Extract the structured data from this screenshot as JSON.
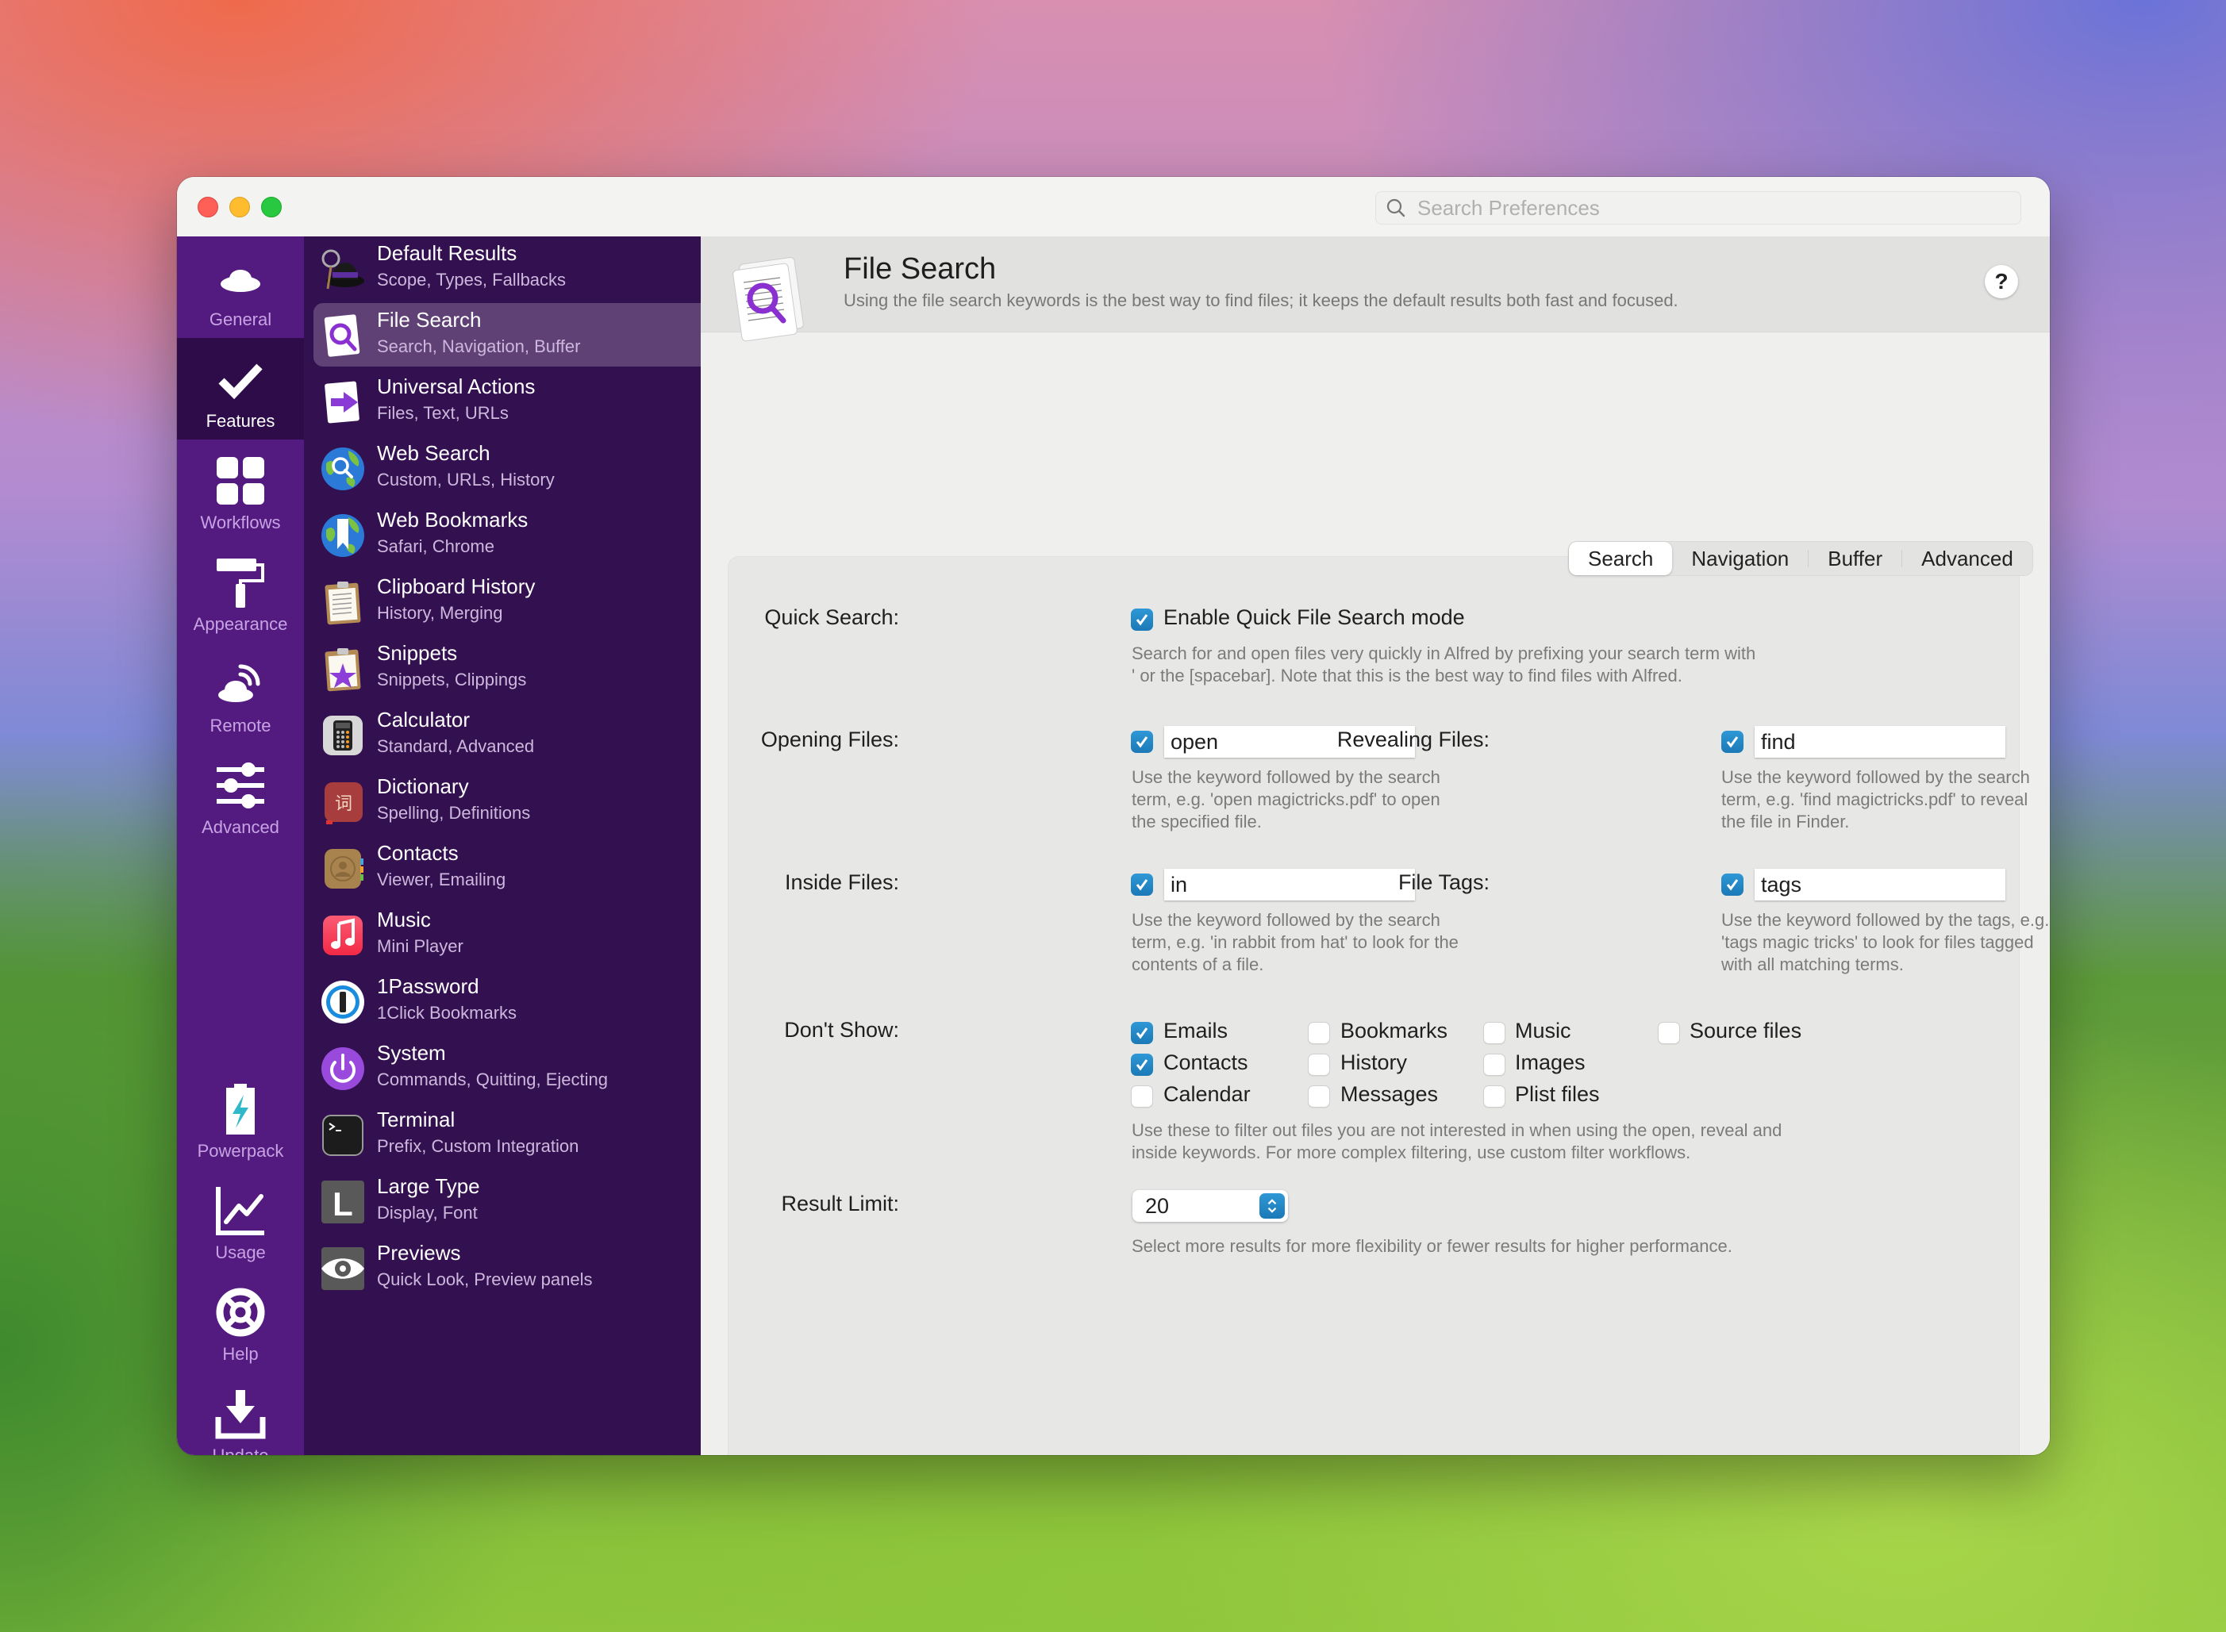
{
  "window": {
    "search_placeholder": "Search Preferences"
  },
  "nav": {
    "items": [
      {
        "label": "General",
        "icon": "hat-icon",
        "selected": false
      },
      {
        "label": "Features",
        "icon": "checkmark-icon",
        "selected": true
      },
      {
        "label": "Workflows",
        "icon": "grid-icon",
        "selected": false
      },
      {
        "label": "Appearance",
        "icon": "paint-roller-icon",
        "selected": false
      },
      {
        "label": "Remote",
        "icon": "remote-hat-icon",
        "selected": false
      },
      {
        "label": "Advanced",
        "icon": "sliders-icon",
        "selected": false
      },
      {
        "label": "Powerpack",
        "icon": "battery-bolt-icon",
        "selected": false
      },
      {
        "label": "Usage",
        "icon": "line-chart-icon",
        "selected": false
      },
      {
        "label": "Help",
        "icon": "lifebuoy-icon",
        "selected": false
      },
      {
        "label": "Update",
        "icon": "download-icon",
        "selected": false
      }
    ]
  },
  "features": [
    {
      "title": "Default Results",
      "subtitle": "Scope, Types, Fallbacks",
      "icon": "alfred-hat-icon"
    },
    {
      "title": "File Search",
      "subtitle": "Search, Navigation, Buffer",
      "icon": "file-search-icon",
      "selected": true
    },
    {
      "title": "Universal Actions",
      "subtitle": "Files, Text, URLs",
      "icon": "universal-actions-icon"
    },
    {
      "title": "Web Search",
      "subtitle": "Custom, URLs, History",
      "icon": "globe-search-icon"
    },
    {
      "title": "Web Bookmarks",
      "subtitle": "Safari, Chrome",
      "icon": "globe-bookmark-icon"
    },
    {
      "title": "Clipboard History",
      "subtitle": "History, Merging",
      "icon": "clipboard-icon"
    },
    {
      "title": "Snippets",
      "subtitle": "Snippets, Clippings",
      "icon": "snippets-icon"
    },
    {
      "title": "Calculator",
      "subtitle": "Standard, Advanced",
      "icon": "calculator-icon"
    },
    {
      "title": "Dictionary",
      "subtitle": "Spelling, Definitions",
      "icon": "dictionary-icon"
    },
    {
      "title": "Contacts",
      "subtitle": "Viewer, Emailing",
      "icon": "contacts-icon"
    },
    {
      "title": "Music",
      "subtitle": "Mini Player",
      "icon": "music-icon"
    },
    {
      "title": "1Password",
      "subtitle": "1Click Bookmarks",
      "icon": "1password-icon"
    },
    {
      "title": "System",
      "subtitle": "Commands, Quitting, Ejecting",
      "icon": "power-icon"
    },
    {
      "title": "Terminal",
      "subtitle": "Prefix, Custom Integration",
      "icon": "terminal-icon"
    },
    {
      "title": "Large Type",
      "subtitle": "Display, Font",
      "icon": "large-type-icon"
    },
    {
      "title": "Previews",
      "subtitle": "Quick Look, Preview panels",
      "icon": "eye-icon"
    }
  ],
  "header": {
    "title": "File Search",
    "description": "Using the file search keywords is the best way to find files; it keeps the default results both fast and focused.",
    "help_label": "?"
  },
  "tabs": [
    {
      "label": "Search",
      "active": true
    },
    {
      "label": "Navigation",
      "active": false
    },
    {
      "label": "Buffer",
      "active": false
    },
    {
      "label": "Advanced",
      "active": false
    }
  ],
  "form": {
    "quick_search": {
      "label": "Quick Search:",
      "checkbox_label": "Enable Quick File Search mode",
      "checked": true,
      "hint": "Search for and open files very quickly in Alfred by prefixing your search term with\n' or the [spacebar]. Note that this is the best way to find files with Alfred."
    },
    "opening_files": {
      "label": "Opening Files:",
      "checked": true,
      "value": "open",
      "hint": "Use the keyword followed by the search\nterm, e.g. 'open magictricks.pdf' to open\nthe specified file."
    },
    "revealing_files": {
      "label": "Revealing Files:",
      "checked": true,
      "value": "find",
      "hint": "Use the keyword followed by the search\nterm, e.g. 'find magictricks.pdf' to reveal\nthe file in Finder."
    },
    "inside_files": {
      "label": "Inside Files:",
      "checked": true,
      "value": "in",
      "hint": "Use the keyword followed by the search\nterm, e.g. 'in rabbit from hat' to look for the\ncontents of a file."
    },
    "file_tags": {
      "label": "File Tags:",
      "checked": true,
      "value": "tags",
      "hint": "Use the keyword followed by the tags, e.g.\n'tags magic tricks' to look for files tagged\nwith all matching terms."
    },
    "dont_show": {
      "label": "Don't Show:",
      "options": [
        {
          "label": "Emails",
          "checked": true
        },
        {
          "label": "Contacts",
          "checked": true
        },
        {
          "label": "Calendar",
          "checked": false
        },
        {
          "label": "Bookmarks",
          "checked": false
        },
        {
          "label": "History",
          "checked": false
        },
        {
          "label": "Messages",
          "checked": false
        },
        {
          "label": "Music",
          "checked": false
        },
        {
          "label": "Images",
          "checked": false
        },
        {
          "label": "Plist files",
          "checked": false
        },
        {
          "label": "Source files",
          "checked": false
        }
      ],
      "hint": "Use these to filter out files you are not interested in when using the open, reveal and\ninside keywords. For more complex filtering, use custom filter workflows."
    },
    "result_limit": {
      "label": "Result Limit:",
      "value": "20",
      "hint": "Select more results for more flexibility or fewer results for higher performance."
    }
  },
  "colors": {
    "accent": "#1f86c4",
    "nav_bg": "#531b80",
    "nav_selected_bg": "#2e0c4a",
    "features_bg": "#33104f",
    "feature_selected_bg": "#5f4176"
  }
}
